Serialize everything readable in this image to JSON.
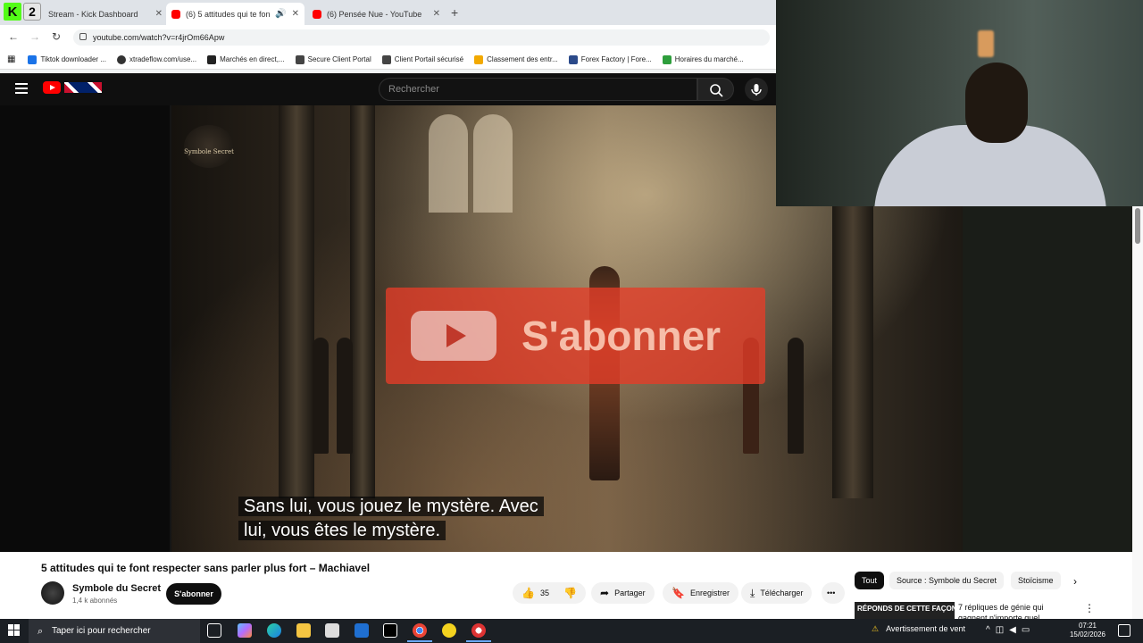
{
  "browser": {
    "tabs": [
      {
        "label": "Stream - Kick Dashboard",
        "favicon": "kick-icon",
        "active": false
      },
      {
        "label": "(6) 5 attitudes qui te font re",
        "favicon": "youtube-icon",
        "active": true
      },
      {
        "label": "(6) Pensée Nue - YouTube",
        "favicon": "youtube-icon",
        "active": false
      }
    ],
    "kick_badge": "K",
    "badge_number": "2",
    "url": "youtube.com/watch?v=r4jrOm66Apw",
    "bookmarks": [
      "Tiktok downloader ...",
      "xtradeflow.com/use...",
      "Marchés en direct,...",
      "Secure Client Portal",
      "Client Portail sécurisé",
      "Classement des entr...",
      "Forex Factory | Fore...",
      "Horaires du marché..."
    ]
  },
  "youtube": {
    "search_placeholder": "Rechercher",
    "video": {
      "watermark": "Symbole Secret",
      "overlay_text": "S'abonner",
      "caption_line1": "Sans lui, vous jouez le mystère. Avec",
      "caption_line2": "lui, vous êtes le mystère."
    },
    "title": "5 attitudes qui te font respecter sans parler plus fort – Machiavel",
    "channel": {
      "name": "Symbole du Secret",
      "subscribers": "1,4 k abonnés",
      "subscribe_label": "S'abonner"
    },
    "actions": {
      "likes": "35",
      "share": "Partager",
      "save": "Enregistrer",
      "download": "Télécharger"
    },
    "chips": [
      "Tout",
      "Source : Symbole du Secret",
      "Stoïcisme"
    ],
    "recommendation": {
      "thumb_text": "RÉPONDS DE CETTE FAÇON",
      "title": "7 répliques de génie qui gagnent n'importe quel"
    }
  },
  "taskbar": {
    "search_placeholder": "Taper ici pour rechercher",
    "weather": "Avertissement de vent",
    "time": "07:21",
    "date": "15/02/2026"
  },
  "colors": {
    "youtube_red": "#ff0000",
    "kick_green": "#53fc18",
    "taskbar": "#1b1f24"
  }
}
